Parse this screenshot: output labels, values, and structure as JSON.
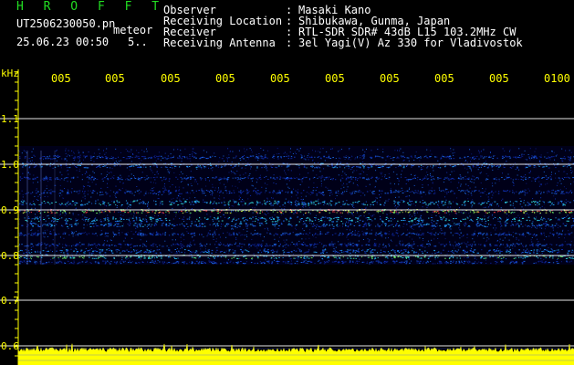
{
  "header": {
    "title": "H R O F F T",
    "filename": "UT2506230050.pn",
    "mode": "meteor",
    "datetime": "25.06.23 00:50",
    "counter": "5..",
    "info": [
      {
        "label": "Observer",
        "value": "Masaki Kano"
      },
      {
        "label": "Receiving Location",
        "value": "Shibukawa, Gunma, Japan"
      },
      {
        "label": "Receiver",
        "value": "RTL-SDR SDR# 43dB L15 103.2MHz CW"
      },
      {
        "label": "Receiving Antenna",
        "value": "3el Yagi(V) Az 330 for Vladivostok"
      }
    ],
    "separator": ":"
  },
  "axis": {
    "unit": "kHz",
    "y_ticks": [
      "1.1",
      "1.0",
      "0.9",
      "0.8",
      "0.7",
      "0.6"
    ],
    "x_ticks": [
      "005",
      "005",
      "005",
      "005",
      "005",
      "005",
      "005",
      "005",
      "005",
      "0100"
    ]
  },
  "colors": {
    "background": "#000000",
    "labels": "#ffff00",
    "title": "#22dd22",
    "text": "#ffffff"
  }
}
